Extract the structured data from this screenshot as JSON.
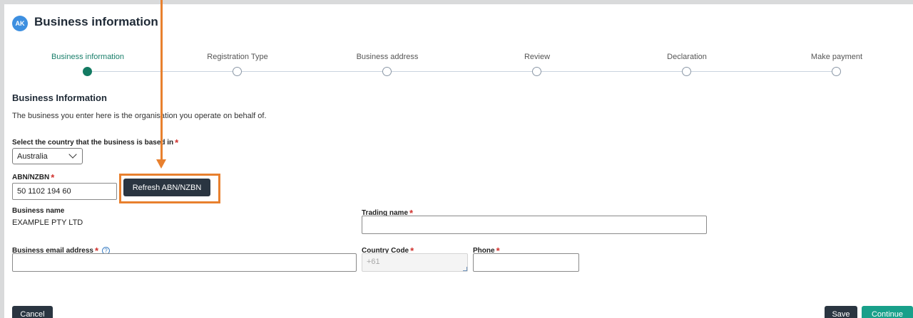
{
  "header": {
    "avatar_initials": "AK",
    "title": "Business information"
  },
  "stepper": {
    "steps": [
      {
        "label": "Business information",
        "active": true
      },
      {
        "label": "Registration Type",
        "active": false
      },
      {
        "label": "Business address",
        "active": false
      },
      {
        "label": "Review",
        "active": false
      },
      {
        "label": "Declaration",
        "active": false
      },
      {
        "label": "Make payment",
        "active": false
      }
    ]
  },
  "section": {
    "title": "Business Information",
    "description": "The business you enter here is the organisation you operate on behalf of."
  },
  "form": {
    "country_label": "Select the country that the business is based in",
    "country_value": "Australia",
    "abn_label": "ABN/NZBN",
    "abn_value": "50 1102 194 60",
    "refresh_button": "Refresh ABN/NZBN",
    "business_name_label": "Business name",
    "business_name_value": "EXAMPLE PTY LTD",
    "trading_name_label": "Trading name",
    "trading_name_value": "",
    "email_label": "Business email address",
    "email_value": "",
    "country_code_label": "Country Code",
    "country_code_placeholder": "+61",
    "phone_label": "Phone",
    "phone_value": "",
    "required_marker": "*",
    "help_icon_glyph": "?"
  },
  "footer": {
    "cancel": "Cancel",
    "save": "Save",
    "continue": "Continue"
  },
  "colors": {
    "accent_green": "#137a62",
    "continue_green": "#18a08a",
    "dark_button": "#2a3541",
    "highlight_orange": "#e8802e",
    "required_red": "#d0312d"
  },
  "icons": {
    "avatar": "avatar-circle",
    "country_dropdown": "chevron-down-icon",
    "email_help": "help-circle-icon",
    "annotation": "arrow-down-icon"
  }
}
